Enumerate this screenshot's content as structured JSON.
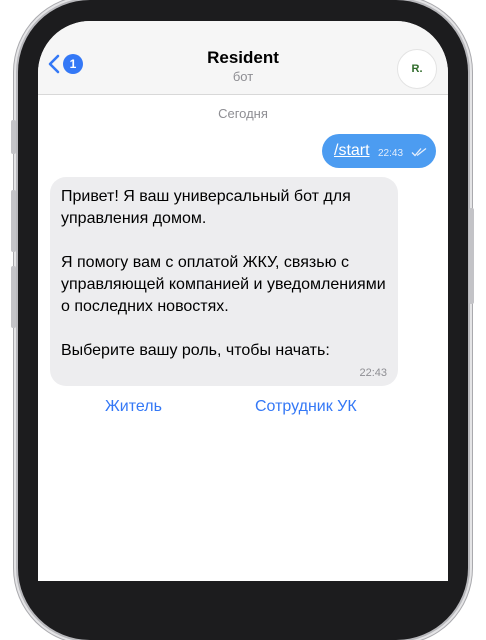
{
  "header": {
    "back_count": "1",
    "title": "Resident",
    "subtitle": "бот",
    "avatar_initials": "R."
  },
  "chat": {
    "date_separator": "Сегодня",
    "messages": [
      {
        "direction": "out",
        "text": "/start",
        "time": "22:43",
        "status": "read"
      },
      {
        "direction": "in",
        "text": "Привет! Я ваш универсальный бот для управления домом.\n\nЯ помогу вам с оплатой ЖКУ, связью с управляющей компанией и уведомлениями о последних новостях.\n\nВыберите вашу роль, чтобы начать:",
        "time": "22:43"
      }
    ],
    "inline_buttons": [
      "Житель",
      "Сотрудник УК"
    ]
  },
  "colors": {
    "accent": "#3478f6",
    "outgoing_bubble": "#4c9cf1",
    "incoming_bubble": "#ededef"
  }
}
